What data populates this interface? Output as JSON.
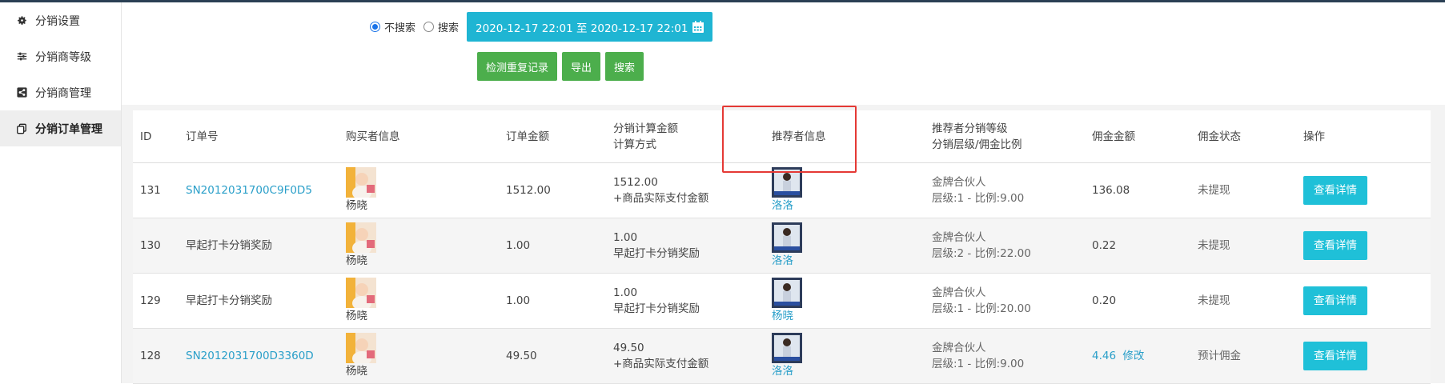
{
  "sidebar": {
    "items": [
      {
        "label": "分销设置",
        "icon": "gear-icon"
      },
      {
        "label": "分销商等级",
        "icon": "sliders-icon"
      },
      {
        "label": "分销商管理",
        "icon": "share-icon"
      },
      {
        "label": "分销订单管理",
        "icon": "copy-icon"
      }
    ]
  },
  "search": {
    "radio_no": "不搜索",
    "radio_yes": "搜索",
    "selected": "不搜索",
    "date_range": "2020-12-17 22:01 至 2020-12-17 22:01",
    "calendar_icon": "calendar-icon"
  },
  "actions": {
    "check_dup": "检测重复记录",
    "export": "导出",
    "search": "搜索"
  },
  "colors": {
    "accent_cyan": "#1fc0d8",
    "green": "#4cae4c",
    "link": "#2a9fc9",
    "highlight": "#e53935"
  },
  "table": {
    "headers": {
      "id": "ID",
      "order": "订单号",
      "buyer": "购买者信息",
      "amount": "订单金额",
      "calc1": "分销计算金额",
      "calc2": "计算方式",
      "ref": "推荐者信息",
      "level1": "推荐者分销等级",
      "level2": "分销层级/佣金比例",
      "comm": "佣金金额",
      "status": "佣金状态",
      "op": "操作"
    },
    "rows": [
      {
        "id": "131",
        "order": "SN2012031700C9F0D5",
        "order_link": true,
        "buyer": "杨晓",
        "amount": "1512.00",
        "calc_amount": "1512.00",
        "calc_method": "+商品实际支付金额",
        "ref": "洛洛",
        "level": "金牌合伙人",
        "level_detail": "层级:1 - 比例:9.00",
        "comm": "136.08",
        "comm_edit": "",
        "status": "未提现",
        "op": "查看详情"
      },
      {
        "id": "130",
        "order": "早起打卡分销奖励",
        "order_link": false,
        "buyer": "杨晓",
        "amount": "1.00",
        "calc_amount": "1.00",
        "calc_method": "早起打卡分销奖励",
        "ref": "洛洛",
        "level": "金牌合伙人",
        "level_detail": "层级:2 - 比例:22.00",
        "comm": "0.22",
        "comm_edit": "",
        "status": "未提现",
        "op": "查看详情"
      },
      {
        "id": "129",
        "order": "早起打卡分销奖励",
        "order_link": false,
        "buyer": "杨晓",
        "amount": "1.00",
        "calc_amount": "1.00",
        "calc_method": "早起打卡分销奖励",
        "ref": "杨晓",
        "level": "金牌合伙人",
        "level_detail": "层级:1 - 比例:20.00",
        "comm": "0.20",
        "comm_edit": "",
        "status": "未提现",
        "op": "查看详情"
      },
      {
        "id": "128",
        "order": "SN2012031700D3360D",
        "order_link": true,
        "buyer": "杨晓",
        "amount": "49.50",
        "calc_amount": "49.50",
        "calc_method": "+商品实际支付金额",
        "ref": "洛洛",
        "level": "金牌合伙人",
        "level_detail": "层级:1 - 比例:9.00",
        "comm": "4.46",
        "comm_edit": "修改",
        "status": "预计佣金",
        "op": "查看详情"
      }
    ]
  }
}
